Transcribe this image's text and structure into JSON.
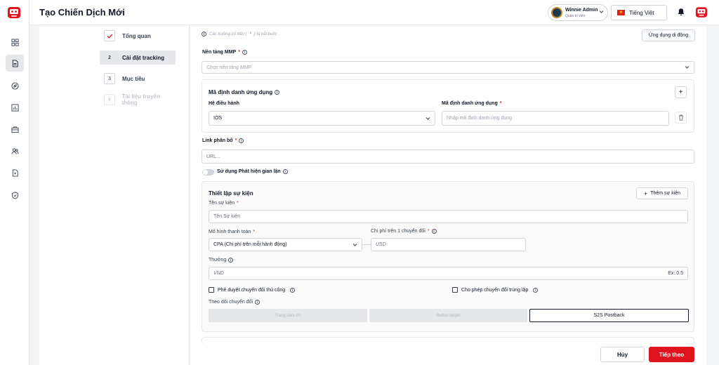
{
  "header": {
    "title": "Tạo Chiến Dịch Mới",
    "user": {
      "name": "Winnie Admin",
      "role": "Quản trị viên"
    },
    "language": "Tiếng Việt"
  },
  "colors": {
    "brand": "#e0141e",
    "active_step_bg": "#e5e7eb",
    "toggle_off": "#d1d5db"
  },
  "rail": {
    "icons": [
      "logo-icon",
      "dashboard-icon",
      "document-icon",
      "compass-icon",
      "chart-icon",
      "briefcase-icon",
      "users-icon",
      "file-icon",
      "shield-icon"
    ]
  },
  "steps": [
    {
      "num": "✓",
      "label": "Tổng quan",
      "state": "done"
    },
    {
      "num": "2",
      "label": "Cài đặt tracking",
      "state": "active"
    },
    {
      "num": "3",
      "label": "Mục tiêu",
      "state": "pending"
    },
    {
      "num": "4",
      "label": "Tài liệu truyền thông",
      "state": "disabled"
    }
  ],
  "form": {
    "required_note": {
      "prefix": "Các trường có dấu (",
      "star": "*",
      "suffix": ") là bắt buộc"
    },
    "app_type_button": "Ứng dụng di động",
    "mmp": {
      "label": "Nền tảng MMP",
      "placeholder": "Chọn nền tảng MMP"
    },
    "app_id_card": {
      "title": "Mã định danh ứng dụng",
      "add": "+",
      "os_label": "Hệ điều hành",
      "os_value": "IOS",
      "id_label": "Mã định danh ứng dụng",
      "id_placeholder": "Nhập mã định danh ứng dụng"
    },
    "link": {
      "label": "Link phân bổ",
      "placeholder": "URL..."
    },
    "fraud_toggle": {
      "label": "Sử dụng Phát hiện gian lận",
      "on": false
    },
    "events": {
      "title": "Thiết lập sự kiện",
      "add_button": "Thêm sự kiện",
      "name_label": "Tên sự kiện",
      "name_placeholder": "Tên Sự kiện",
      "payment_label": "Mô hình thanh toán",
      "payment_value": "CPA (Chi phí trên mỗi hành động)",
      "cost_label": "Chi phí trên 1 chuyển đổi",
      "cost_placeholder": "USD",
      "reward_label": "Thưởng",
      "reward_placeholder": "VND",
      "reward_hint": "Ex: 0.5",
      "manual_approval": "Phê duyệt chuyển đổi thủ công",
      "allow_duplicate": "Cho phép chuyển đổi trùng lặp",
      "tracking_label": "Theo dõi chuyển đổi",
      "tracking_options": [
        "Trang cảm ơn",
        "Button target",
        "S2S Postback"
      ],
      "tracking_selected": "S2S Postback"
    }
  },
  "footer": {
    "cancel": "Hủy",
    "next": "Tiếp theo"
  }
}
